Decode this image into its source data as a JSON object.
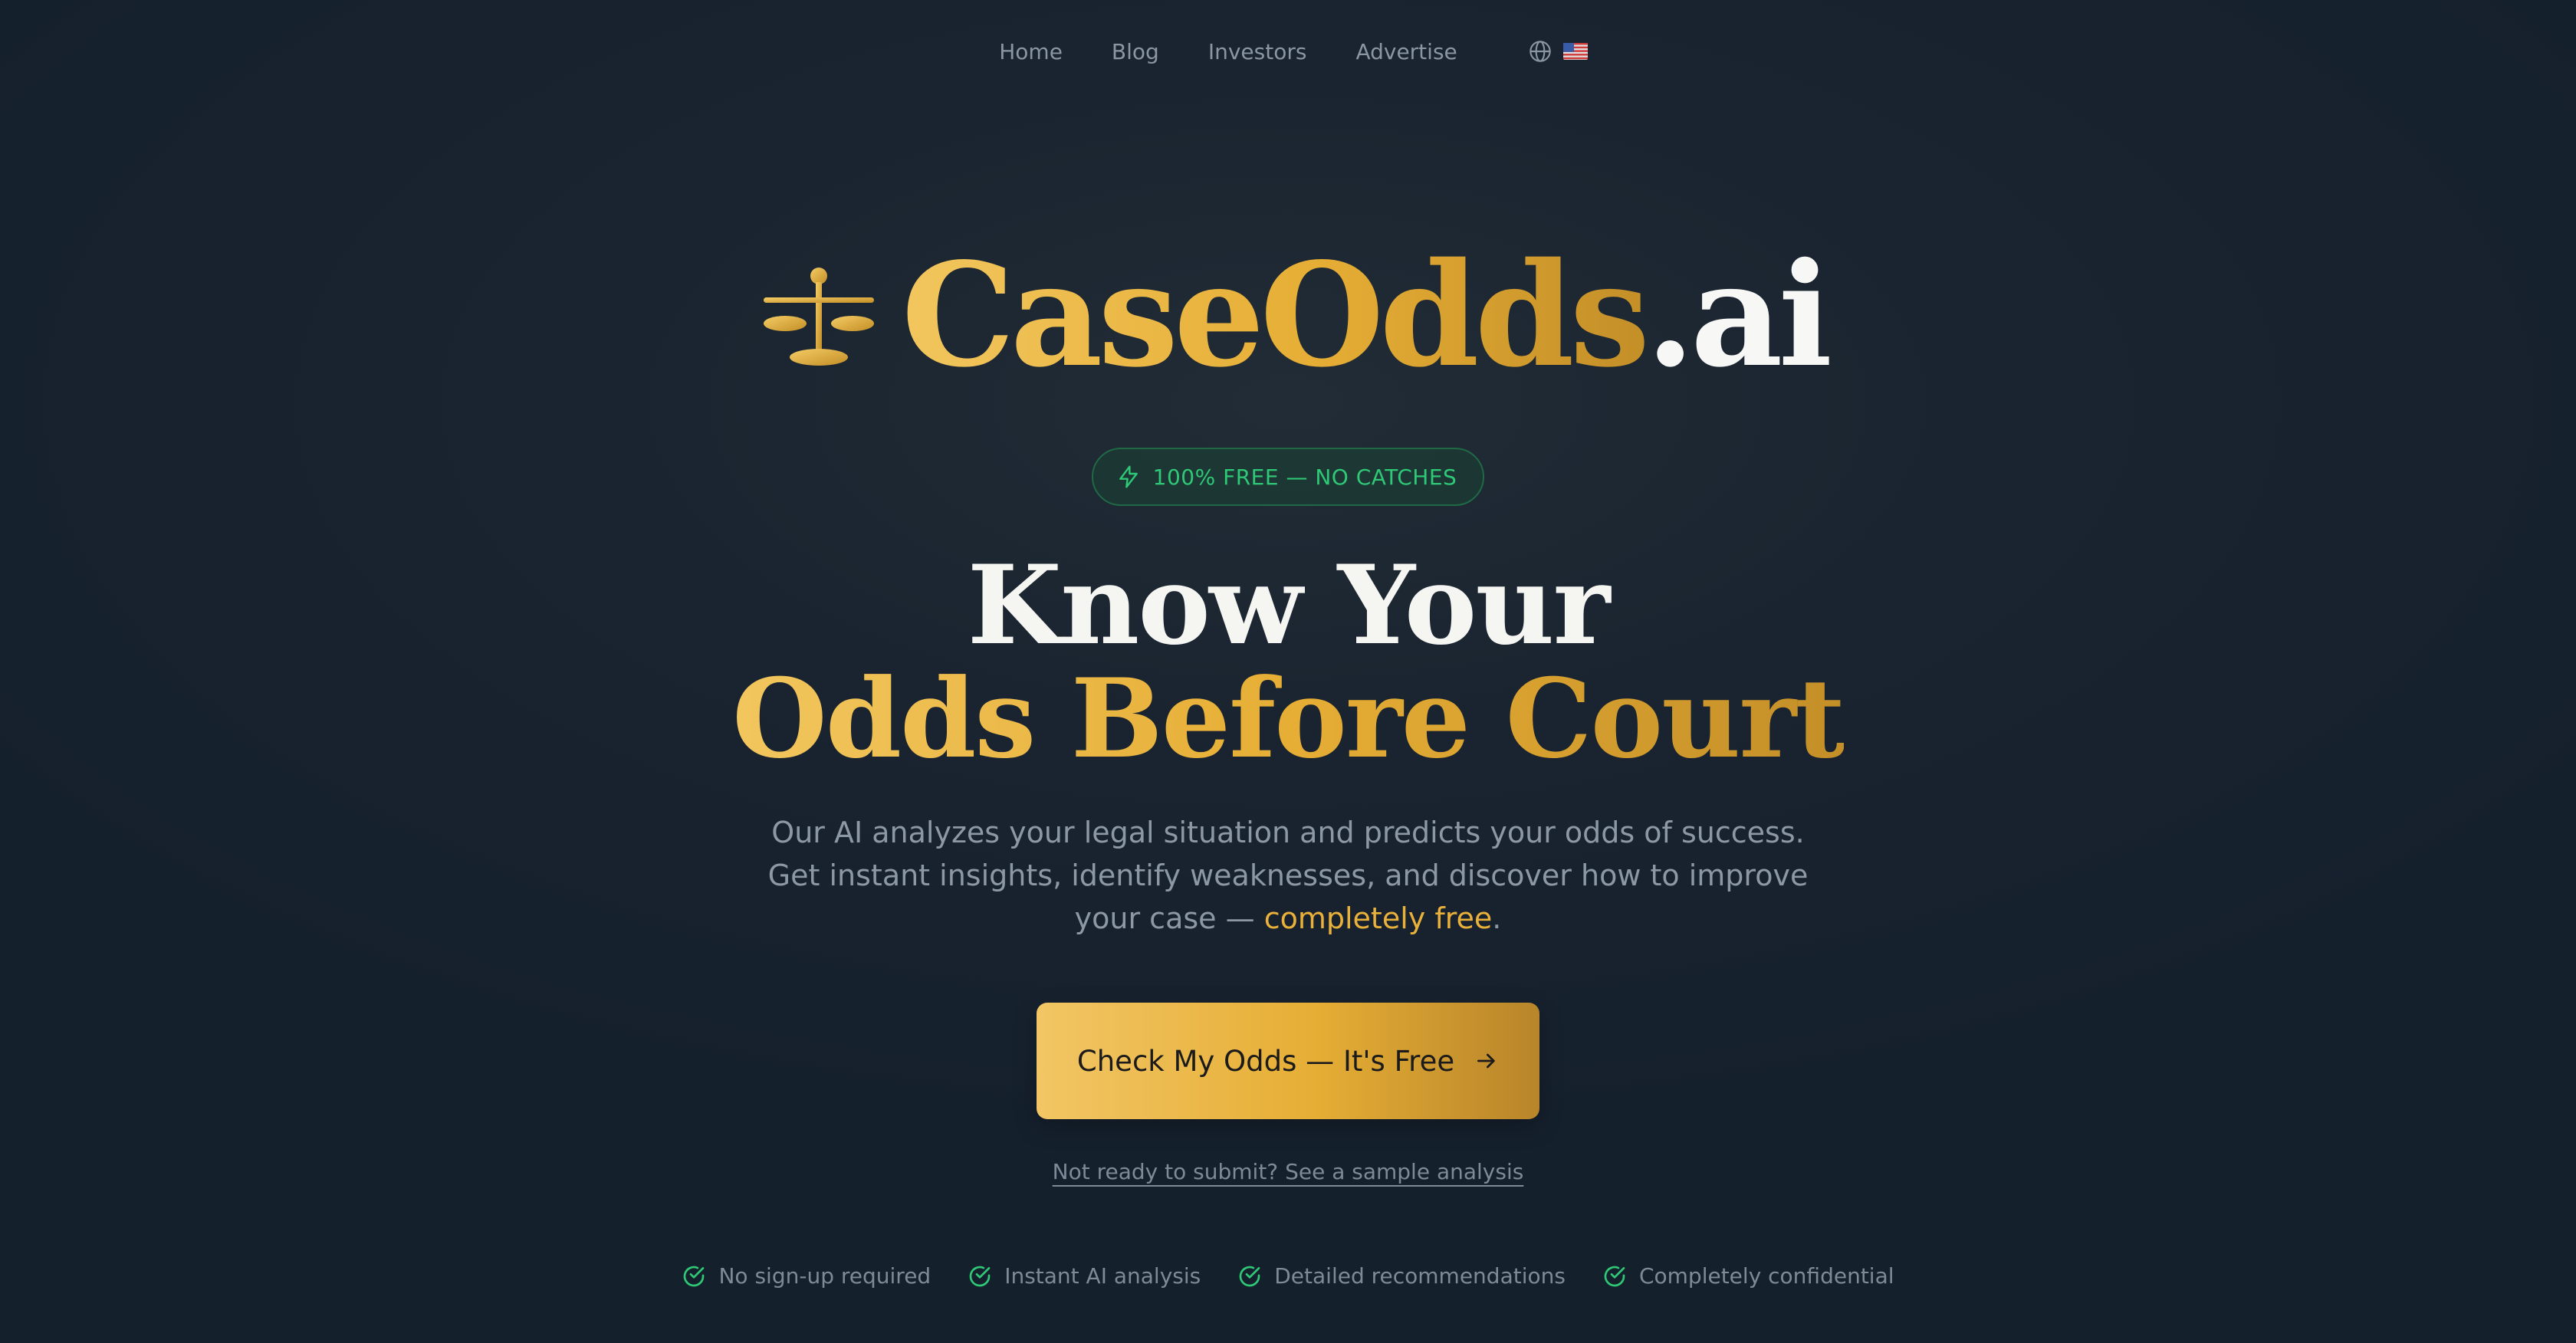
{
  "nav": {
    "items": [
      "Home",
      "Blog",
      "Investors",
      "Advertise"
    ],
    "language_icon": "globe-icon",
    "flag": "us-flag"
  },
  "logo": {
    "icon": "scales-icon",
    "brand_main": "CaseOdds",
    "brand_suffix": ".ai"
  },
  "badge": {
    "icon": "lightning-icon",
    "text": "100% FREE — NO CATCHES"
  },
  "headline": {
    "line1": "Know Your",
    "line2": "Odds Before Court"
  },
  "subtext": {
    "main": "Our AI analyzes your legal situation and predicts your odds of success. Get instant insights, identify weaknesses, and discover how to improve your case — ",
    "highlight": "completely free",
    "end": "."
  },
  "cta": {
    "label": "Check My Odds — It's Free",
    "icon": "arrow-right-icon"
  },
  "sample_link": "Not ready to submit? See a sample analysis",
  "features": [
    "No sign-up required",
    "Instant AI analysis",
    "Detailed recommendations",
    "Completely confidential"
  ],
  "colors": {
    "background": "#1a2430",
    "gold": "#e6ae35",
    "green": "#2fc876",
    "muted": "#8d98a6"
  }
}
